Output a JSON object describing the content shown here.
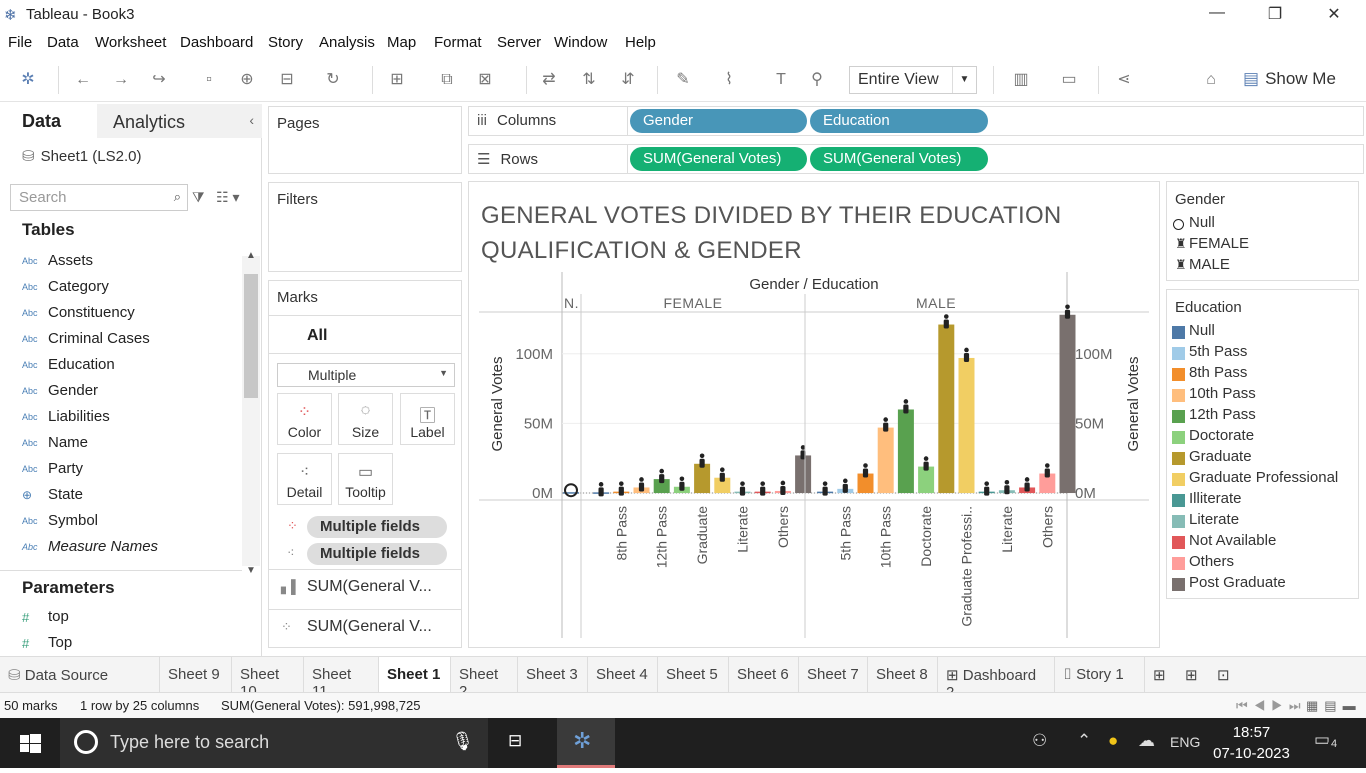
{
  "window": {
    "title": "Tableau - Book3"
  },
  "menu": [
    "File",
    "Data",
    "Worksheet",
    "Dashboard",
    "Story",
    "Analysis",
    "Map",
    "Format",
    "Server",
    "Window",
    "Help"
  ],
  "toolbar": {
    "fit": "Entire View",
    "show_me": "Show Me"
  },
  "data_pane": {
    "tab_data": "Data",
    "tab_analytics": "Analytics",
    "datasource": "Sheet1 (LS2.0)",
    "search_placeholder": "Search",
    "tables_heading": "Tables",
    "fields": [
      {
        "type": "Abc",
        "name": "Assets"
      },
      {
        "type": "Abc",
        "name": "Category"
      },
      {
        "type": "Abc",
        "name": "Constituency"
      },
      {
        "type": "Abc",
        "name": "Criminal Cases"
      },
      {
        "type": "Abc",
        "name": "Education"
      },
      {
        "type": "Abc",
        "name": "Gender"
      },
      {
        "type": "Abc",
        "name": "Liabilities"
      },
      {
        "type": "Abc",
        "name": "Name"
      },
      {
        "type": "Abc",
        "name": "Party"
      },
      {
        "type": "globe",
        "name": "State"
      },
      {
        "type": "Abc",
        "name": "Symbol"
      },
      {
        "type": "Abc",
        "name": "Measure Names"
      }
    ],
    "parameters_heading": "Parameters",
    "parameters": [
      "top",
      "Top"
    ]
  },
  "pages": {
    "title": "Pages"
  },
  "filters": {
    "title": "Filters"
  },
  "marks": {
    "title": "Marks",
    "all": "All",
    "mark_type": "Multiple",
    "buttons": {
      "color": "Color",
      "size": "Size",
      "label": "Label",
      "detail": "Detail",
      "tooltip": "Tooltip"
    },
    "pills": [
      "Multiple fields",
      "Multiple fields"
    ],
    "measures": [
      "SUM(General V...",
      "SUM(General V..."
    ]
  },
  "shelves": {
    "columns_label": "Columns",
    "rows_label": "Rows",
    "columns": [
      "Gender",
      "Education"
    ],
    "rows": [
      "SUM(General Votes)",
      "SUM(General Votes)"
    ]
  },
  "chart_data": {
    "type": "bar",
    "title": "GENERAL VOTES DIVIDED BY THEIR EDUCATION QUALIFICATION & GENDER",
    "header": "Gender / Education",
    "ylabel": "General Votes",
    "ylabel_right": "General Votes",
    "ylim": [
      -5000000,
      130000000
    ],
    "yticks": [
      {
        "value": 0,
        "label": "0M"
      },
      {
        "value": 50000000,
        "label": "50M"
      },
      {
        "value": 100000000,
        "label": "100M"
      }
    ],
    "panes": [
      {
        "gender": "N.",
        "categories": [
          {
            "label": "",
            "value": 600000,
            "color": "#4e79a7"
          }
        ]
      },
      {
        "gender": "FEMALE",
        "categories": [
          {
            "label": "",
            "value": 500000,
            "color": "#4e79a7"
          },
          {
            "label": "8th Pass",
            "value": 1000000,
            "color": "#f28e2b"
          },
          {
            "label": "",
            "value": 4000000,
            "color": "#ffbe7d"
          },
          {
            "label": "12th Pass",
            "value": 10000000,
            "color": "#59a14f"
          },
          {
            "label": "",
            "value": 4500000,
            "color": "#8cd17d"
          },
          {
            "label": "Graduate",
            "value": 21000000,
            "color": "#b6992d"
          },
          {
            "label": "",
            "value": 11000000,
            "color": "#f1ce63"
          },
          {
            "label": "Literate",
            "value": 1000000,
            "color": "#86bcb6"
          },
          {
            "label": "",
            "value": 1000000,
            "color": "#e15759"
          },
          {
            "label": "Others",
            "value": 1500000,
            "color": "#ff9d9a"
          },
          {
            "label": "",
            "value": 27000000,
            "color": "#79706e"
          }
        ]
      },
      {
        "gender": "MALE",
        "categories": [
          {
            "label": "",
            "value": 1000000,
            "color": "#4e79a7"
          },
          {
            "label": "5th Pass",
            "value": 3000000,
            "color": "#a0cbe8"
          },
          {
            "label": "",
            "value": 14000000,
            "color": "#f28e2b"
          },
          {
            "label": "10th Pass",
            "value": 47000000,
            "color": "#ffbe7d"
          },
          {
            "label": "",
            "value": 60000000,
            "color": "#59a14f"
          },
          {
            "label": "Doctorate",
            "value": 19000000,
            "color": "#8cd17d"
          },
          {
            "label": "",
            "value": 121000000,
            "color": "#b6992d"
          },
          {
            "label": "Graduate Professi..",
            "value": 97000000,
            "color": "#f1ce63"
          },
          {
            "label": "",
            "value": 1000000,
            "color": "#499894"
          },
          {
            "label": "Literate",
            "value": 2000000,
            "color": "#86bcb6"
          },
          {
            "label": "",
            "value": 4000000,
            "color": "#e15759"
          },
          {
            "label": "Others",
            "value": 14000000,
            "color": "#ff9d9a"
          },
          {
            "label": "",
            "value": 128000000,
            "color": "#79706e"
          }
        ]
      }
    ]
  },
  "legend_gender": {
    "title": "Gender",
    "items": [
      {
        "icon": "circle",
        "label": "Null"
      },
      {
        "icon": "person",
        "label": "FEMALE"
      },
      {
        "icon": "person",
        "label": "MALE"
      }
    ]
  },
  "legend_education": {
    "title": "Education",
    "items": [
      {
        "label": "Null",
        "color": "#4e79a7"
      },
      {
        "label": "5th Pass",
        "color": "#a0cbe8"
      },
      {
        "label": "8th Pass",
        "color": "#f28e2b"
      },
      {
        "label": "10th Pass",
        "color": "#ffbe7d"
      },
      {
        "label": "12th Pass",
        "color": "#59a14f"
      },
      {
        "label": "Doctorate",
        "color": "#8cd17d"
      },
      {
        "label": "Graduate",
        "color": "#b6992d"
      },
      {
        "label": "Graduate Professional",
        "color": "#f1ce63"
      },
      {
        "label": "Illiterate",
        "color": "#499894"
      },
      {
        "label": "Literate",
        "color": "#86bcb6"
      },
      {
        "label": "Not Available",
        "color": "#e15759"
      },
      {
        "label": "Others",
        "color": "#ff9d9a"
      },
      {
        "label": "Post Graduate",
        "color": "#79706e"
      }
    ]
  },
  "sheet_tabs": [
    "Data Source",
    "Sheet 9",
    "Sheet 10",
    "Sheet 11",
    "Sheet 1",
    "Sheet 2",
    "Sheet 3",
    "Sheet 4",
    "Sheet 5",
    "Sheet 6",
    "Sheet 7",
    "Sheet 8",
    "Dashboard 2",
    "Story 1"
  ],
  "active_tab": "Sheet 1",
  "status": {
    "marks": "50 marks",
    "dims": "1 row by 25 columns",
    "sum": "SUM(General Votes): 591,998,725"
  },
  "taskbar": {
    "search_placeholder": "Type here to search",
    "lang": "ENG",
    "time": "18:57",
    "date": "07-10-2023",
    "notifications": "4"
  }
}
